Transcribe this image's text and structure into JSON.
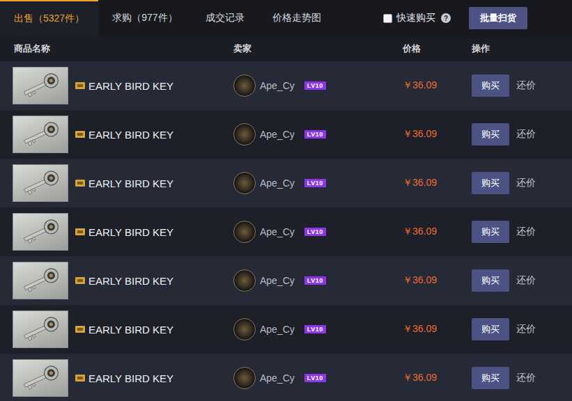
{
  "tabs": [
    {
      "label": "出售（5327件）",
      "selected": true
    },
    {
      "label": "求购（977件）",
      "selected": false
    },
    {
      "label": "成交记录",
      "selected": false
    },
    {
      "label": "价格走势图",
      "selected": false
    }
  ],
  "quick_buy": {
    "label": "快速购买",
    "checked": false,
    "help": "?"
  },
  "batch_button": "批量扫货",
  "table": {
    "columns": [
      "商品名称",
      "卖家",
      "价格",
      "操作"
    ],
    "rows": [
      {
        "name": "EARLY BIRD KEY",
        "seller": "Ape_Cy",
        "level": "LV10",
        "price": "￥36.09",
        "buy": "购买",
        "counter": "还价"
      },
      {
        "name": "EARLY BIRD KEY",
        "seller": "Ape_Cy",
        "level": "LV10",
        "price": "￥36.09",
        "buy": "购买",
        "counter": "还价"
      },
      {
        "name": "EARLY BIRD KEY",
        "seller": "Ape_Cy",
        "level": "LV10",
        "price": "￥36.09",
        "buy": "购买",
        "counter": "还价"
      },
      {
        "name": "EARLY BIRD KEY",
        "seller": "Ape_Cy",
        "level": "LV10",
        "price": "￥36.09",
        "buy": "购买",
        "counter": "还价"
      },
      {
        "name": "EARLY BIRD KEY",
        "seller": "Ape_Cy",
        "level": "LV10",
        "price": "￥36.09",
        "buy": "购买",
        "counter": "还价"
      },
      {
        "name": "EARLY BIRD KEY",
        "seller": "Ape_Cy",
        "level": "LV10",
        "price": "￥36.09",
        "buy": "购买",
        "counter": "还价"
      },
      {
        "name": "EARLY BIRD KEY",
        "seller": "Ape_Cy",
        "level": "LV10",
        "price": "￥36.09",
        "buy": "购买",
        "counter": "还价"
      }
    ]
  }
}
